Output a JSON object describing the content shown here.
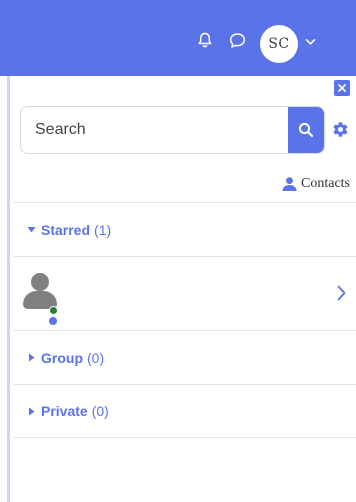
{
  "header": {
    "avatar_initials": "SC",
    "icons": [
      "bell-icon",
      "chat-bubble-icon",
      "chevron-down-icon"
    ]
  },
  "panel": {
    "search": {
      "placeholder": "Search",
      "value": ""
    },
    "contacts_label": "Contacts",
    "sections": {
      "starred": {
        "label": "Starred",
        "count": "(1)",
        "expanded": true
      },
      "group": {
        "label": "Group",
        "count": "(0)",
        "expanded": false
      },
      "private": {
        "label": "Private",
        "count": "(0)",
        "expanded": false
      }
    }
  },
  "colors": {
    "accent": "#5a73e8",
    "online": "#2e7d32",
    "avatar_gray": "#808080"
  }
}
